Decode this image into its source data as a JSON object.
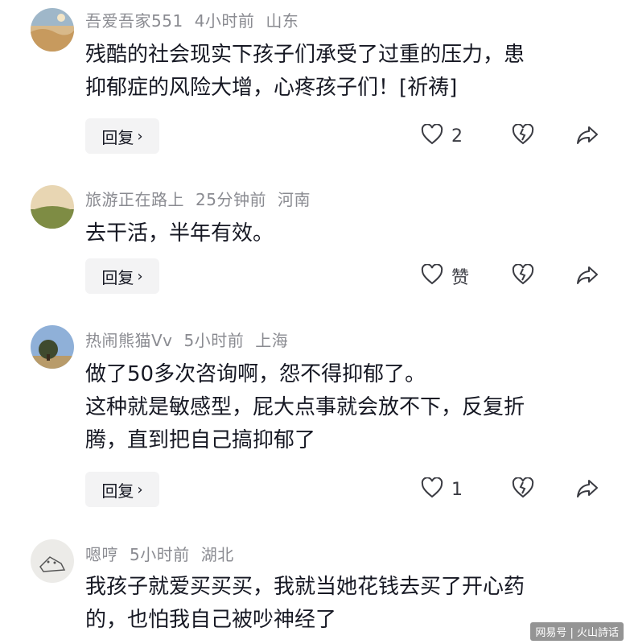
{
  "comments": [
    {
      "username": "吾爱吾家551",
      "time": "4小时前",
      "location": "山东",
      "lines": [
        "残酷的社会现实下孩子们承受了过重的压力，患",
        "抑郁症的风险大增，心疼孩子们！[祈祷]"
      ],
      "reply_label": "回复",
      "like_count": "2"
    },
    {
      "username": "旅游正在路上",
      "time": "25分钟前",
      "location": "河南",
      "lines": [
        "去干活，半年有效。"
      ],
      "reply_label": "回复",
      "like_count": "赞"
    },
    {
      "username": "热闹熊猫Vv",
      "time": "5小时前",
      "location": "上海",
      "lines": [
        "做了50多次咨询啊，怨不得抑郁了。",
        "这种就是敏感型，屁大点事就会放不下，反复折",
        "腾，直到把自己搞抑郁了"
      ],
      "reply_label": "回复",
      "like_count": "1"
    },
    {
      "username": "嗯哼",
      "time": "5小时前",
      "location": "湖北",
      "lines": [
        "我孩子就爱买买买，我就当她花钱去买了开心药",
        "的，也怕我自己被吵神经了"
      ]
    }
  ],
  "icons": {
    "like": "heart-outline-icon",
    "dislike": "broken-heart-icon",
    "share": "share-arrow-icon",
    "reply_chevron": "chevron-right-icon"
  },
  "watermark": "网易号 | 火山詩话",
  "colors": {
    "text": "#161823",
    "meta": "#8a8b91",
    "reply_bg": "#f3f3f4",
    "icon": "#3a3b42"
  }
}
